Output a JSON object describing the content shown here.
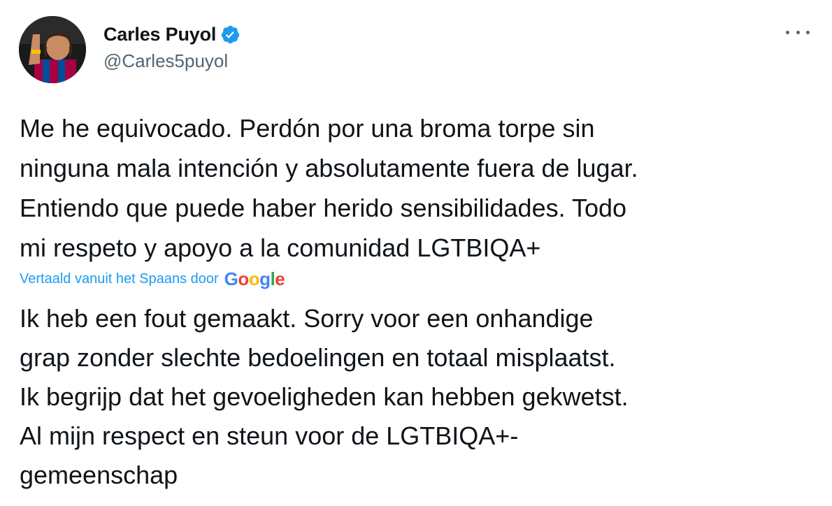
{
  "author": {
    "name": "Carles Puyol",
    "handle": "@Carles5puyol",
    "verified": true,
    "avatar_icon": "profile-photo"
  },
  "menu": {
    "icon": "more-horizontal-icon"
  },
  "tweet": {
    "text": "Me he equivocado. Perdón por una broma torpe sin\nninguna mala intención y absolutamente fuera de lugar.\nEntiendo que puede haber herido sensibilidades. Todo\nmi respeto y apoyo a la comunidad LGTBIQA+"
  },
  "translation": {
    "label": "Vertaald vanuit het Spaans door",
    "provider": {
      "letters": [
        "G",
        "o",
        "o",
        "g",
        "l",
        "e"
      ]
    },
    "text": "Ik heb een fout gemaakt. Sorry voor een onhandige\ngrap zonder slechte bedoelingen en totaal misplaatst.\nIk begrijp dat het gevoeligheden kan hebben gekwetst.\nAl mijn respect en steun voor de LGTBIQA+-\ngemeenschap"
  },
  "colors": {
    "text": "#0f1419",
    "secondary": "#536471",
    "accent": "#1d9bf0",
    "google_blue": "#4285f4",
    "google_red": "#ea4335",
    "google_yellow": "#fbbc05",
    "google_green": "#34a853"
  }
}
